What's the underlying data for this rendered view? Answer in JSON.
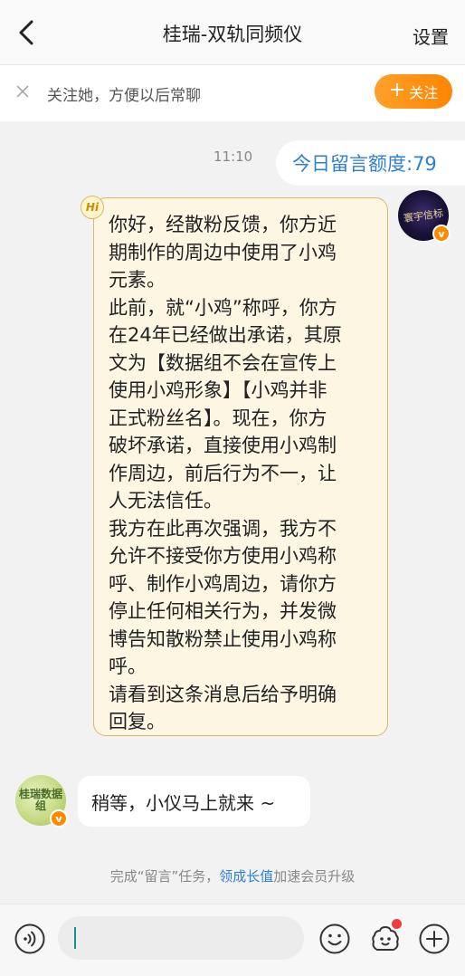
{
  "header": {
    "title": "桂瑞-双轨同频仪",
    "settings_label": "设置"
  },
  "follow_bar": {
    "text": "关注她，方便以后常聊",
    "button_label": "关注"
  },
  "chat": {
    "time": "11:10",
    "quota": "今日留言额度:79",
    "hi_badge": "Hi",
    "message_lines": [
      "你好，经散粉反馈，你方近",
      "期制作的周边中使用了小鸡",
      "元素。",
      "此前，就“小鸡”称呼，你方",
      "在24年已经做出承诺，其原",
      "文为【数据组不会在宣传上",
      "使用小鸡形象】【小鸡并非",
      "正式粉丝名】。现在，你方",
      "破坏承诺，直接使用小鸡制",
      "作周边，前后行为不一，让",
      "人无法信任。",
      "我方在此再次强调，我方不",
      "允许不接受你方使用小鸡称",
      "呼、制作小鸡周边，请你方",
      "停止任何相关行为，并发微",
      "博告知散粉禁止使用小鸡称",
      "呼。",
      "请看到这条消息后给予明确",
      "回复。"
    ],
    "user_avatar_text": "寰宇信标",
    "reply_text": "稍等，小仪马上就来 ~",
    "bot_avatar_text": "桂瑞数据组",
    "verified_mark": "v"
  },
  "task": {
    "prefix": "完成“留言”任务，",
    "link": "领成长值",
    "suffix": "加速会员升级"
  },
  "input": {
    "placeholder": ""
  },
  "colors": {
    "accent_orange": "#ff8a00",
    "link_blue": "#2f7fd0",
    "bubble_bg": "#fdf6e3",
    "bubble_border": "#d8b96a"
  }
}
